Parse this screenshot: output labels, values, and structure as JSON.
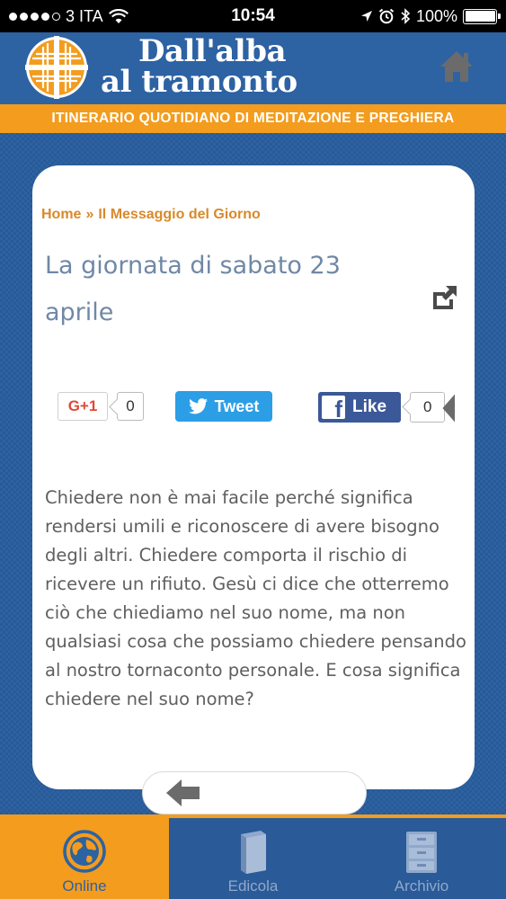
{
  "status_bar": {
    "carrier": "3 ITA",
    "time": "10:54",
    "battery": "100%",
    "battery_level": 1.0,
    "icons": [
      "wifi-icon",
      "location-icon",
      "alarm-icon",
      "bluetooth-icon",
      "battery-icon"
    ]
  },
  "header": {
    "logo_line1": "Dall'alba",
    "logo_line2": "al tramonto",
    "tagline": "ITINERARIO QUOTIDIANO DI MEDITAZIONE E PREGHIERA",
    "home_icon": "home-icon"
  },
  "breadcrumb": {
    "home": "Home",
    "separator": "»",
    "current": "Il Messaggio del Giorno"
  },
  "article": {
    "title": "La giornata di sabato 23 aprile",
    "body": "Chiedere non è mai facile perché significa rendersi umili e riconoscere di avere bisogno degli altri. Chiedere comporta il rischio di ricevere un rifiuto. Gesù ci dice che otterremo ciò che chiediamo nel suo nome, ma non qualsiasi cosa che possiamo chiedere pensando al nostro tornaconto personale. E cosa significa chiedere nel suo nome?"
  },
  "social": {
    "gplus_label": "G+1",
    "gplus_count": "0",
    "tweet_label": "Tweet",
    "fb_label": "Like",
    "fb_count": "0"
  },
  "tabs": [
    {
      "label": "Online",
      "icon": "globe-icon",
      "active": true
    },
    {
      "label": "Edicola",
      "icon": "book-icon",
      "active": false
    },
    {
      "label": "Archivio",
      "icon": "filing-cabinet-icon",
      "active": false
    }
  ],
  "colors": {
    "primary_blue": "#2d62a3",
    "accent_orange": "#f39c1e",
    "breadcrumb_orange": "#d9892a",
    "title_blue_gray": "#7088a6",
    "body_gray": "#5f5f5f",
    "twitter_blue": "#2b9ee6",
    "facebook_blue": "#3b5998",
    "gplus_red": "#dd4b39"
  }
}
